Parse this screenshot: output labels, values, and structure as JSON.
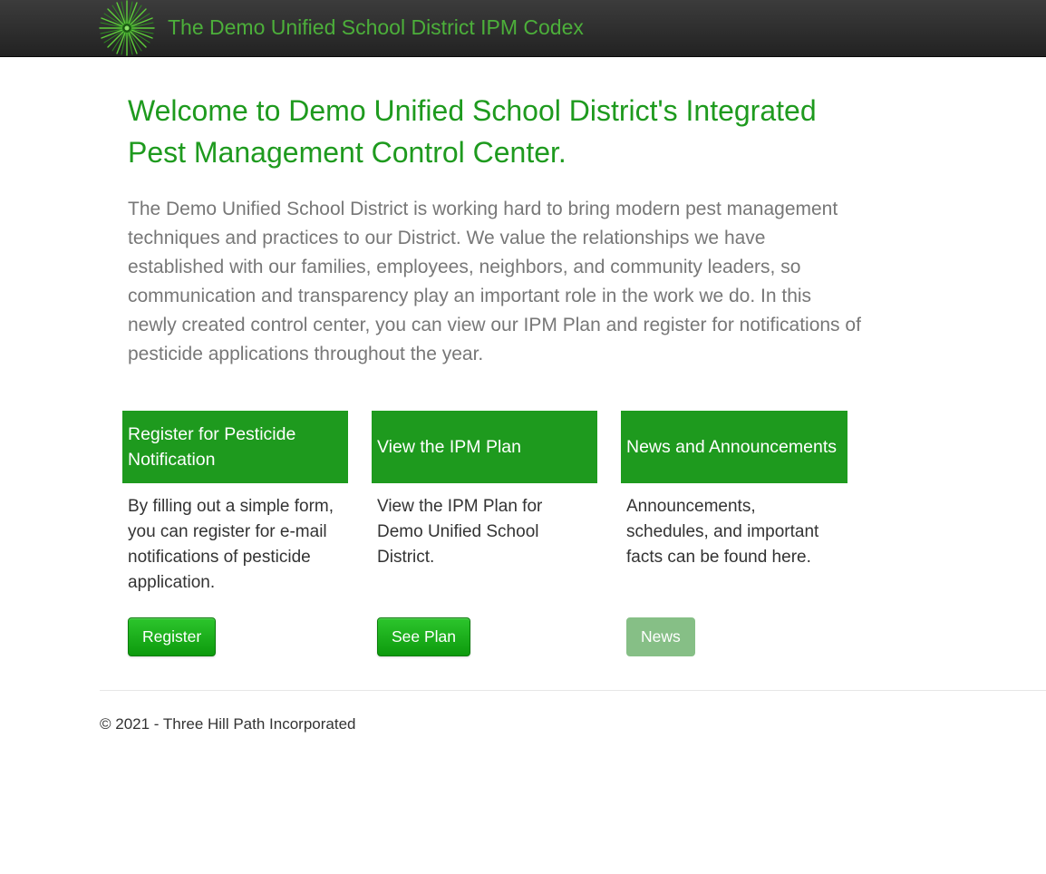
{
  "navbar": {
    "brand_text": "The Demo Unified School District IPM Codex",
    "logo_icon": "green-starburst-logo"
  },
  "main": {
    "title": "Welcome to Demo Unified School District's Integrated Pest Management Control Center.",
    "intro": "The Demo Unified School District is working hard to bring modern pest management techniques and practices to our District. We value the relationships we have established with our families, employees, neighbors, and community leaders, so communication and transparency play an important role in the work we do. In this newly created control center, you can view our IPM Plan and register for notifications of pesticide applications throughout the year."
  },
  "cards": [
    {
      "heading": "Register for Pesticide Notification",
      "text": "By filling out a simple form, you can register for e-mail notifications of pesticide application.",
      "button_label": "Register",
      "button_enabled": true
    },
    {
      "heading": "View the IPM Plan",
      "text": "View the IPM Plan for Demo Unified School District.",
      "button_label": "See Plan",
      "button_enabled": true
    },
    {
      "heading": "News and Announcements",
      "text": "Announcements, schedules, and important facts can be found here.",
      "button_label": "News",
      "button_enabled": false
    }
  ],
  "footer": {
    "text": "© 2021 - Three Hill Path Incorporated"
  },
  "colors": {
    "brand_green": "#1e9a1e",
    "navbar_dark": "#222222",
    "brand_text_green": "#4caf3a",
    "disabled_button": "#86bf86"
  }
}
